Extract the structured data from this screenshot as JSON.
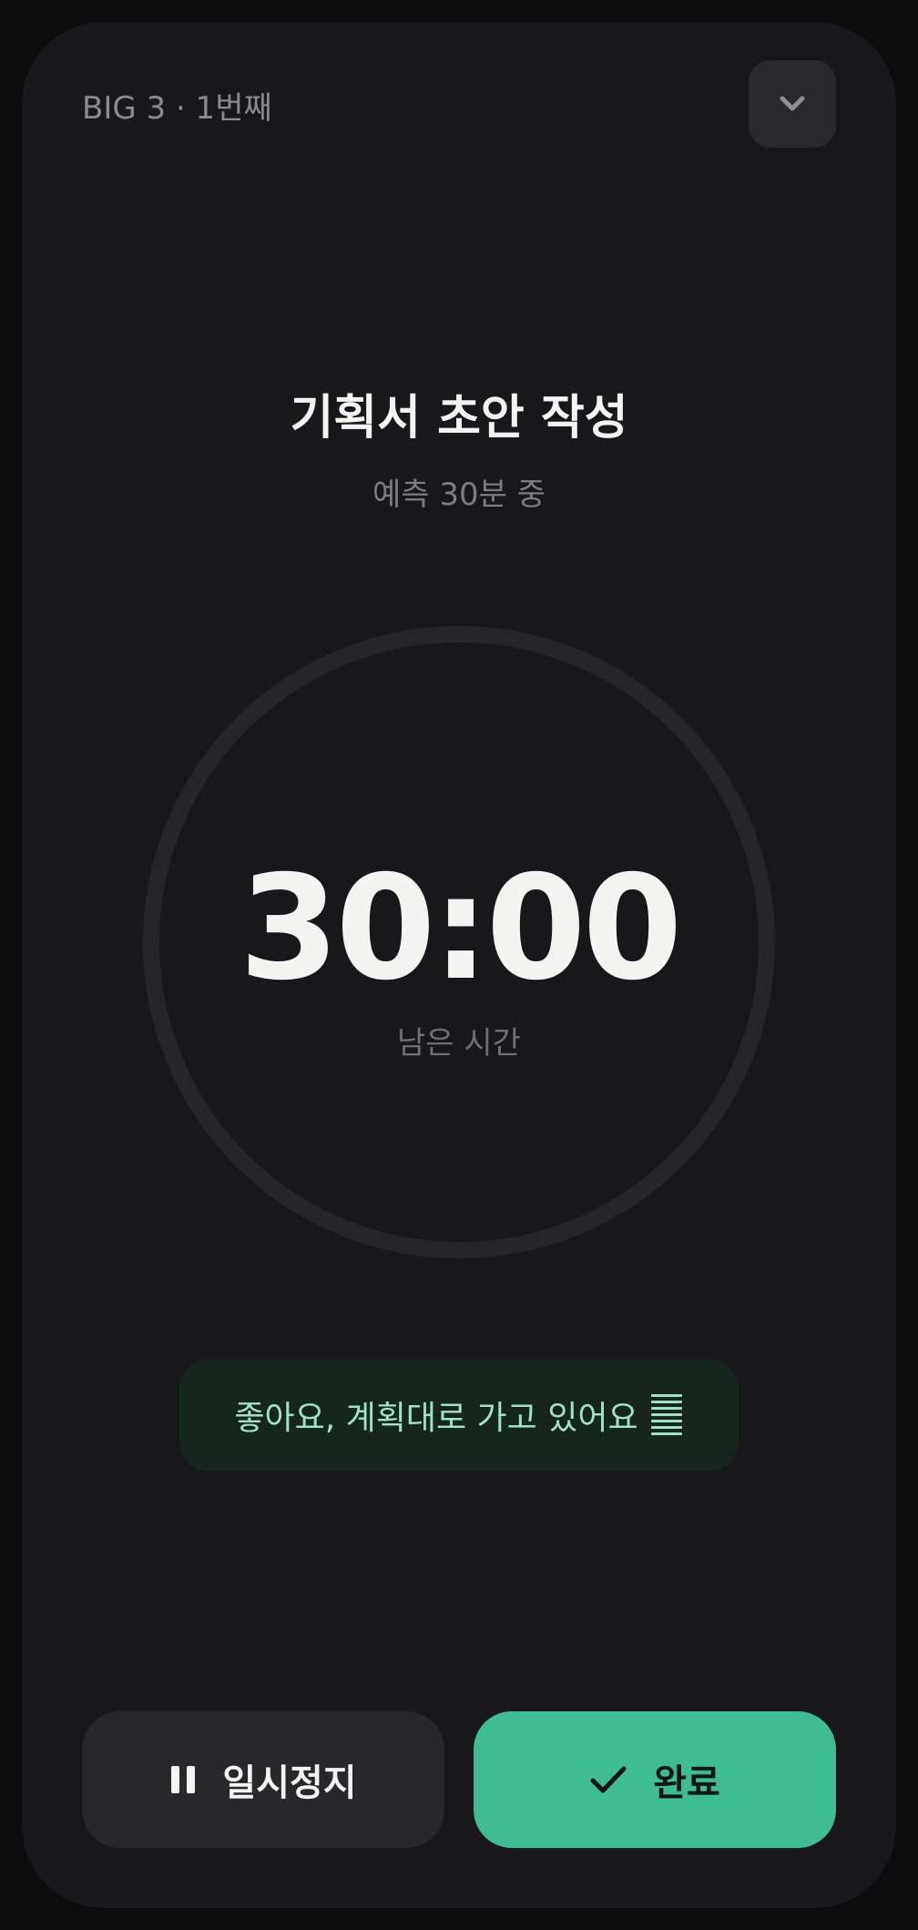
{
  "header": {
    "label": "BIG 3 · 1번째"
  },
  "task": {
    "title": "기획서 초안 작성",
    "subtitle": "예측 30분 중"
  },
  "timer": {
    "time": "30:00",
    "label": "남은 시간",
    "progress": 0
  },
  "status": {
    "message": "좋아요, 계획대로 가고 있어요"
  },
  "actions": {
    "pause_label": "일시정지",
    "done_label": "완료"
  },
  "colors": {
    "background": "#18181a",
    "accent": "#3dbd91",
    "toast_background": "#17251f",
    "toast_text": "#9fe3c4"
  },
  "icons": {
    "collapse": "chevron-down-icon",
    "pause": "pause-icon",
    "done": "check-icon",
    "status": "flow-lines-icon"
  }
}
